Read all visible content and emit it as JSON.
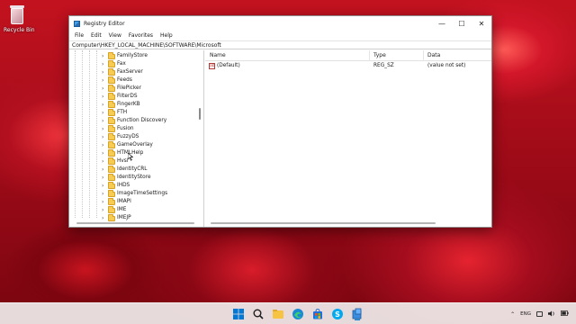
{
  "desktop": {
    "recycle_bin_label": "Recycle Bin"
  },
  "window": {
    "title": "Registry Editor",
    "controls": {
      "minimize": "—",
      "maximize": "☐",
      "close": "✕"
    },
    "menu": [
      "File",
      "Edit",
      "View",
      "Favorites",
      "Help"
    ],
    "address": "Computer\\HKEY_LOCAL_MACHINE\\SOFTWARE\\Microsoft"
  },
  "tree": {
    "items": [
      "FamilyStore",
      "Fax",
      "FaxServer",
      "Feeds",
      "FilePicker",
      "FilterDS",
      "FingerKB",
      "FTH",
      "Function Discovery",
      "Fusion",
      "FuzzyDS",
      "GameOverlay",
      "HTMLHelp",
      "Hvsi",
      "IdentityCRL",
      "IdentityStore",
      "IHDS",
      "ImageTimeSettings",
      "IMAPI",
      "IME",
      "IMEJP"
    ]
  },
  "list": {
    "columns": {
      "name": "Name",
      "type": "Type",
      "data": "Data"
    },
    "rows": [
      {
        "icon": "ab",
        "name": "(Default)",
        "type": "REG_SZ",
        "data": "(value not set)"
      }
    ]
  },
  "taskbar": {
    "icons": [
      "windows-start-icon",
      "search-icon",
      "file-explorer-icon",
      "edge-icon",
      "store-icon",
      "skype-icon",
      "registry-editor-icon"
    ],
    "language": "ENG"
  },
  "colors": {
    "accent_blue": "#0078d4",
    "folder_yellow": "#f6cc55",
    "wallpaper_red": "#c3121f"
  }
}
